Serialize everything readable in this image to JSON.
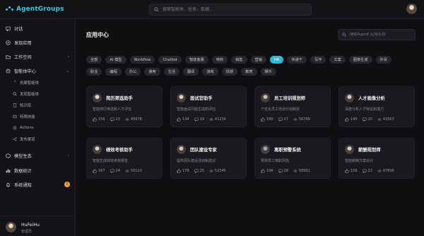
{
  "app": {
    "name": "AgentGroups"
  },
  "header": {
    "search_placeholder": "搜索智能体、任务、数据..."
  },
  "sidebar": {
    "items": [
      {
        "label": "对话",
        "icon": "chat-icon"
      },
      {
        "label": "发现应用",
        "icon": "discover-icon"
      },
      {
        "label": "工作空间",
        "icon": "folder-icon",
        "chevron": "›"
      },
      {
        "label": "智能体中心",
        "icon": "agent-icon",
        "chevron": "⌄"
      },
      {
        "label": "模型生态",
        "icon": "model-icon",
        "chevron": "›"
      },
      {
        "label": "数据统计",
        "icon": "chart-icon"
      },
      {
        "label": "系统通知",
        "icon": "bell-icon",
        "badge": "!"
      }
    ],
    "sub_items": [
      {
        "label": "创建智能体",
        "icon": "magic-icon"
      },
      {
        "label": "发现智能体",
        "icon": "search-icon"
      },
      {
        "label": "知识库",
        "icon": "book-icon"
      },
      {
        "label": "特殊技能",
        "icon": "skill-icon"
      },
      {
        "label": "Actions",
        "icon": "action-icon"
      },
      {
        "label": "发布渠道",
        "icon": "share-icon"
      }
    ],
    "user": {
      "name": "HuFeiHu",
      "role": "管理员"
    }
  },
  "main": {
    "title": "应用中心",
    "search_placeholder": "搜索Agent 应用名称",
    "tags_row1": [
      "全部",
      "AI 模型",
      "Workflow",
      "Chatbot",
      "智能客服",
      "电商",
      "销售",
      "营销",
      "HR",
      "快递干",
      "写作",
      "文案",
      "图像生成",
      "外贸"
    ],
    "tags_row2": [
      "职业",
      "编程",
      "办公",
      "通用",
      "生活",
      "翻译",
      "游戏",
      "情感",
      "教育",
      "娱乐"
    ],
    "active_tag": "HR",
    "cards": [
      {
        "name": "简历筛选助手",
        "desc": "智能简历筛选和人才评估",
        "likes": "156",
        "comments": "23",
        "views": "45678",
        "avatar": "#cfd6de"
      },
      {
        "name": "面试官助手",
        "desc": "智能面试问题生成和评估",
        "likes": "134",
        "comments": "19",
        "views": "41234",
        "avatar": "#d9cfc4"
      },
      {
        "name": "员工培训规划师",
        "desc": "个性化员工培训计划制定",
        "likes": "189",
        "comments": "27",
        "views": "56789",
        "avatar": "#c8c0b6"
      },
      {
        "name": "人才画像分析",
        "desc": "深度分析人才特征和潜力",
        "likes": "145",
        "comments": "20",
        "views": "43567",
        "avatar": "#c9cdd2"
      },
      {
        "name": "绩效考核助手",
        "desc": "智能生成绩效考核报告",
        "likes": "167",
        "comments": "24",
        "views": "50123",
        "avatar": "#d6cdc3"
      },
      {
        "name": "团队建设专家",
        "desc": "提供团队建设活动和建议",
        "likes": "178",
        "comments": "25",
        "views": "52345",
        "avatar": "#d2c7bb"
      },
      {
        "name": "离职预警系统",
        "desc": "预测员工离职风险",
        "likes": "198",
        "comments": "28",
        "views": "58901",
        "avatar": "#9aa3b8"
      },
      {
        "name": "薪酬规划师",
        "desc": "智能薪酬方案设计",
        "likes": "156",
        "comments": "22",
        "views": "47890",
        "avatar": "#e2c9b8"
      }
    ]
  }
}
